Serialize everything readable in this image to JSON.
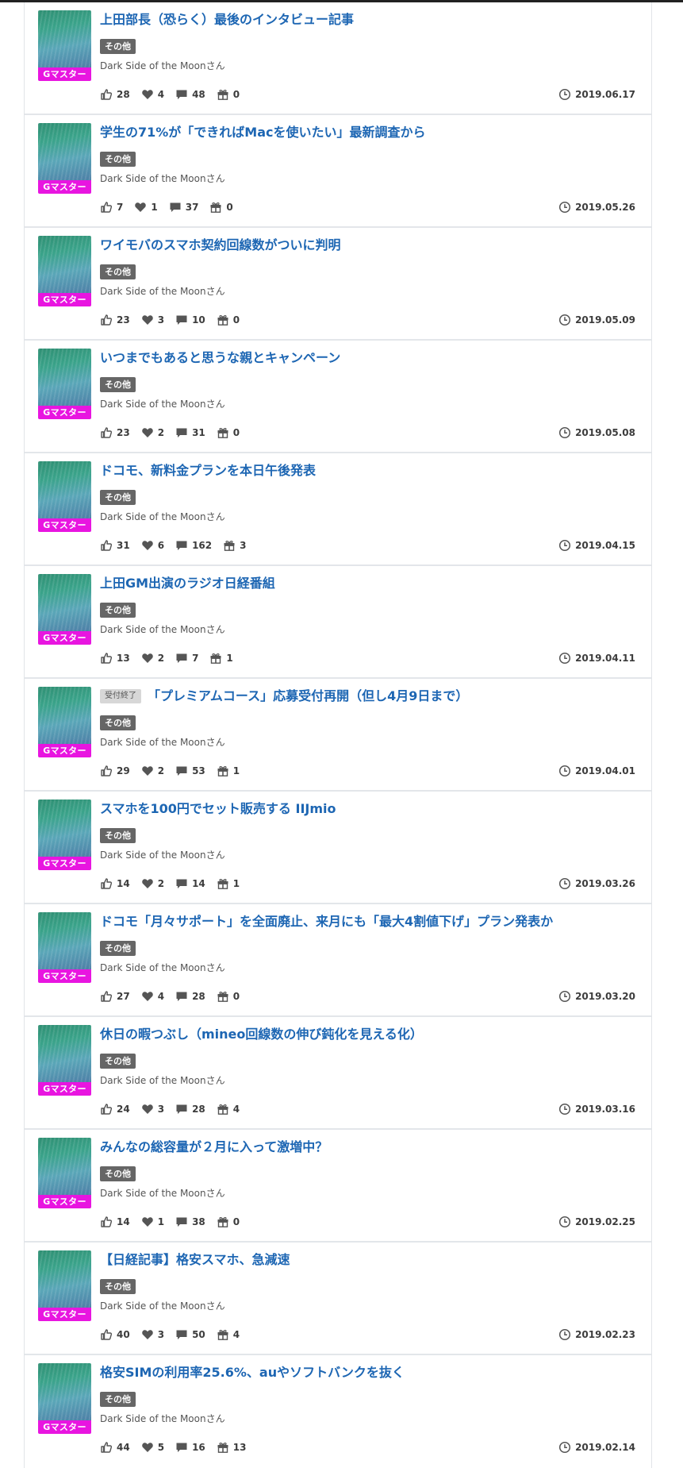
{
  "posts": [
    {
      "closed_tag": "",
      "title": "上田部長（恐らく）最後のインタビュー記事",
      "category": "その他",
      "author": "Dark Side of the Moonさん",
      "badge": "Gマスター",
      "likes": "28",
      "favorites": "4",
      "comments": "48",
      "gifts": "0",
      "date": "2019.06.17"
    },
    {
      "closed_tag": "",
      "title": "学生の71%が「できればMacを使いたい」最新調査から",
      "category": "その他",
      "author": "Dark Side of the Moonさん",
      "badge": "Gマスター",
      "likes": "7",
      "favorites": "1",
      "comments": "37",
      "gifts": "0",
      "date": "2019.05.26"
    },
    {
      "closed_tag": "",
      "title": "ワイモバのスマホ契約回線数がついに判明",
      "category": "その他",
      "author": "Dark Side of the Moonさん",
      "badge": "Gマスター",
      "likes": "23",
      "favorites": "3",
      "comments": "10",
      "gifts": "0",
      "date": "2019.05.09"
    },
    {
      "closed_tag": "",
      "title": "いつまでもあると思うな親とキャンペーン",
      "category": "その他",
      "author": "Dark Side of the Moonさん",
      "badge": "Gマスター",
      "likes": "23",
      "favorites": "2",
      "comments": "31",
      "gifts": "0",
      "date": "2019.05.08"
    },
    {
      "closed_tag": "",
      "title": "ドコモ、新料金プランを本日午後発表",
      "category": "その他",
      "author": "Dark Side of the Moonさん",
      "badge": "Gマスター",
      "likes": "31",
      "favorites": "6",
      "comments": "162",
      "gifts": "3",
      "date": "2019.04.15"
    },
    {
      "closed_tag": "",
      "title": "上田GM出演のラジオ日経番組",
      "category": "その他",
      "author": "Dark Side of the Moonさん",
      "badge": "Gマスター",
      "likes": "13",
      "favorites": "2",
      "comments": "7",
      "gifts": "1",
      "date": "2019.04.11"
    },
    {
      "closed_tag": "受付終了",
      "title": "「プレミアムコース」応募受付再開（但し4月9日まで）",
      "category": "その他",
      "author": "Dark Side of the Moonさん",
      "badge": "Gマスター",
      "likes": "29",
      "favorites": "2",
      "comments": "53",
      "gifts": "1",
      "date": "2019.04.01"
    },
    {
      "closed_tag": "",
      "title": "スマホを100円でセット販売する IIJmio",
      "category": "その他",
      "author": "Dark Side of the Moonさん",
      "badge": "Gマスター",
      "likes": "14",
      "favorites": "2",
      "comments": "14",
      "gifts": "1",
      "date": "2019.03.26"
    },
    {
      "closed_tag": "",
      "title": "ドコモ「月々サポート」を全面廃止、来月にも「最大4割値下げ」プラン発表か",
      "category": "その他",
      "author": "Dark Side of the Moonさん",
      "badge": "Gマスター",
      "likes": "27",
      "favorites": "4",
      "comments": "28",
      "gifts": "0",
      "date": "2019.03.20"
    },
    {
      "closed_tag": "",
      "title": "休日の暇つぶし（mineo回線数の伸び鈍化を見える化）",
      "category": "その他",
      "author": "Dark Side of the Moonさん",
      "badge": "Gマスター",
      "likes": "24",
      "favorites": "3",
      "comments": "28",
      "gifts": "4",
      "date": "2019.03.16"
    },
    {
      "closed_tag": "",
      "title": "みんなの総容量が２月に入って激増中？",
      "category": "その他",
      "author": "Dark Side of the Moonさん",
      "badge": "Gマスター",
      "likes": "14",
      "favorites": "1",
      "comments": "38",
      "gifts": "0",
      "date": "2019.02.25"
    },
    {
      "closed_tag": "",
      "title": "【日経記事】格安スマホ、急減速",
      "category": "その他",
      "author": "Dark Side of the Moonさん",
      "badge": "Gマスター",
      "likes": "40",
      "favorites": "3",
      "comments": "50",
      "gifts": "4",
      "date": "2019.02.23"
    },
    {
      "closed_tag": "",
      "title": "格安SIMの利用率25.6%、auやソフトバンクを抜く",
      "category": "その他",
      "author": "Dark Side of the Moonさん",
      "badge": "Gマスター",
      "likes": "44",
      "favorites": "5",
      "comments": "16",
      "gifts": "13",
      "date": "2019.02.14"
    }
  ],
  "icons": {
    "like": "thumbs-up-icon",
    "favorite": "heart-icon",
    "comment": "comment-icon",
    "gift": "gift-icon",
    "date": "clock-icon"
  },
  "colors": {
    "title_link": "#1d66b3",
    "badge": "#e815e0",
    "category": "#666666",
    "closed_tag": "#d7d7d7"
  }
}
